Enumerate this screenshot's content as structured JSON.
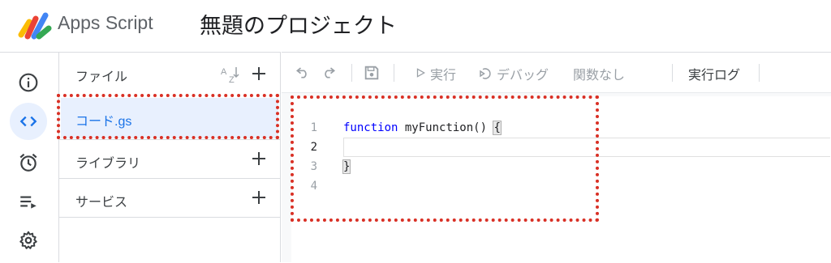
{
  "header": {
    "app_name": "Apps Script",
    "project_title": "無題のプロジェクト"
  },
  "rail": {
    "items": [
      {
        "icon": "info-icon",
        "active": false
      },
      {
        "icon": "code-icon",
        "active": true
      },
      {
        "icon": "alarm-clock-icon",
        "active": false
      },
      {
        "icon": "executions-icon",
        "active": false
      },
      {
        "icon": "gear-icon",
        "active": false
      }
    ]
  },
  "files_panel": {
    "files_label": "ファイル",
    "sort_icon": "sort-az-icon",
    "files": [
      {
        "name": "コード.gs",
        "selected": true
      }
    ],
    "libraries_label": "ライブラリ",
    "services_label": "サービス"
  },
  "toolbar": {
    "run_label": "実行",
    "debug_label": "デバッグ",
    "function_select": "関数なし",
    "exec_log_label": "実行ログ"
  },
  "editor": {
    "lines": [
      {
        "number": "1",
        "keyword": "function",
        "rest": " myFunction() ",
        "brace": "{"
      },
      {
        "number": "2",
        "keyword": "",
        "rest": "",
        "brace": ""
      },
      {
        "number": "3",
        "keyword": "",
        "rest": "",
        "brace": "}"
      },
      {
        "number": "4",
        "keyword": "",
        "rest": "",
        "brace": ""
      }
    ],
    "current_line": "2"
  },
  "colors": {
    "accent": "#1a73e8",
    "highlight": "#d93025",
    "selected_bg": "#e8f0fe",
    "keyword": "#0000ff"
  }
}
